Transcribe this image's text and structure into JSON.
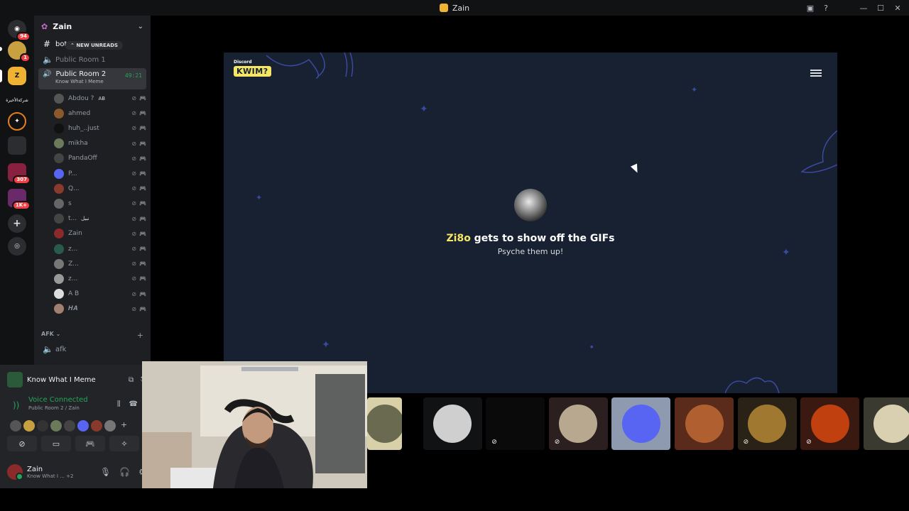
{
  "window": {
    "title": "Zain"
  },
  "guilds": [
    {
      "name": "discord-home",
      "badge": "94",
      "color": "#5865f2"
    },
    {
      "name": "server-1",
      "badge": "1",
      "color": "#c8a040"
    },
    {
      "name": "server-zain",
      "badge": "",
      "color": "#f0b232",
      "label": "Z"
    },
    {
      "name": "server-text",
      "label": "شركةالأخيرة",
      "color": ""
    },
    {
      "name": "server-4",
      "color": "#e67e22"
    },
    {
      "name": "folder-1",
      "color": "#3a6db0"
    },
    {
      "name": "folder-2",
      "badge": "307",
      "color": "#c02060"
    },
    {
      "name": "folder-3",
      "badge": "1K+",
      "color": "#8a2a8a"
    }
  ],
  "sidebar": {
    "server_name": "Zain",
    "new_unreads": "NEW UNREADS",
    "channels": [
      {
        "name": "bot",
        "type": "text"
      },
      {
        "name": "Public Room 1",
        "type": "voice"
      }
    ],
    "active_channel": {
      "name": "Public Room 2",
      "timer": "49:21",
      "activity": "Know What I Meme"
    },
    "voice_users": [
      {
        "name": "Abdou ?",
        "tag": "AB",
        "color": "#555"
      },
      {
        "name": "ahmed",
        "color": "#8a5a2a"
      },
      {
        "name": "huh_..just",
        "color": "#111"
      },
      {
        "name": "mikha",
        "color": "#6a7a5a"
      },
      {
        "name": "PandaOff",
        "color": "#444"
      },
      {
        "name": "P...",
        "color": "#5865f2"
      },
      {
        "name": "Q...",
        "color": "#8a3a2a"
      },
      {
        "name": "s",
        "color": "#666"
      },
      {
        "name": "t...",
        "tag": "نبيل",
        "color": "#444"
      },
      {
        "name": "Zain",
        "color": "#8a2a2a"
      },
      {
        "name": "z...",
        "color": "#2a5a4a"
      },
      {
        "name": "Z...",
        "color": "#777"
      },
      {
        "name": "z...",
        "color": "#999"
      },
      {
        "name": "A B",
        "color": "#ddd"
      },
      {
        "name": "𝑯𝑨",
        "color": "#a08070"
      }
    ],
    "afk_category": "AFK",
    "afk_channel": "afk"
  },
  "panel": {
    "activity_title": "Know What I Meme",
    "voice_status": "Voice Connected",
    "voice_channel": "Public Room 2 / Zain",
    "avatar_colors": [
      "#555",
      "#c8a040",
      "#333",
      "#6a7a5a",
      "#444",
      "#5865f2",
      "#8a3a2a",
      "#777"
    ],
    "user_name": "Zain",
    "user_status": "Know What I ...",
    "user_extra": "+2"
  },
  "stage": {
    "brand_small": "Discord",
    "brand": "KWIM?",
    "player_name": "Zi8o",
    "headline_rest": " gets to show off the GIFs",
    "subline": "Psyche them up!"
  },
  "tiles": [
    {
      "name": "tile-1",
      "bg": "#d8d0a8",
      "pic": "#6a6a50"
    },
    {
      "name": "tile-2",
      "bg": "#111214",
      "pic": "#cfcfcf"
    },
    {
      "name": "tile-3",
      "bg": "#0a0a0a",
      "pic": "#0a0a0a",
      "muted": true
    },
    {
      "name": "tile-4",
      "bg": "#2b1f1f",
      "pic": "#b8a890",
      "muted": true
    },
    {
      "name": "tile-5",
      "bg": "#8e9aaf",
      "pic": "#5865f2"
    },
    {
      "name": "tile-6",
      "bg": "#5a2a1a",
      "pic": "#b06030"
    },
    {
      "name": "tile-7",
      "bg": "#2a2216",
      "pic": "#a07830",
      "muted": true
    },
    {
      "name": "tile-8",
      "bg": "#3a1a10",
      "pic": "#c04010",
      "muted": true
    },
    {
      "name": "tile-9",
      "bg": "#3a3a30",
      "pic": "#d8d0b0"
    }
  ]
}
